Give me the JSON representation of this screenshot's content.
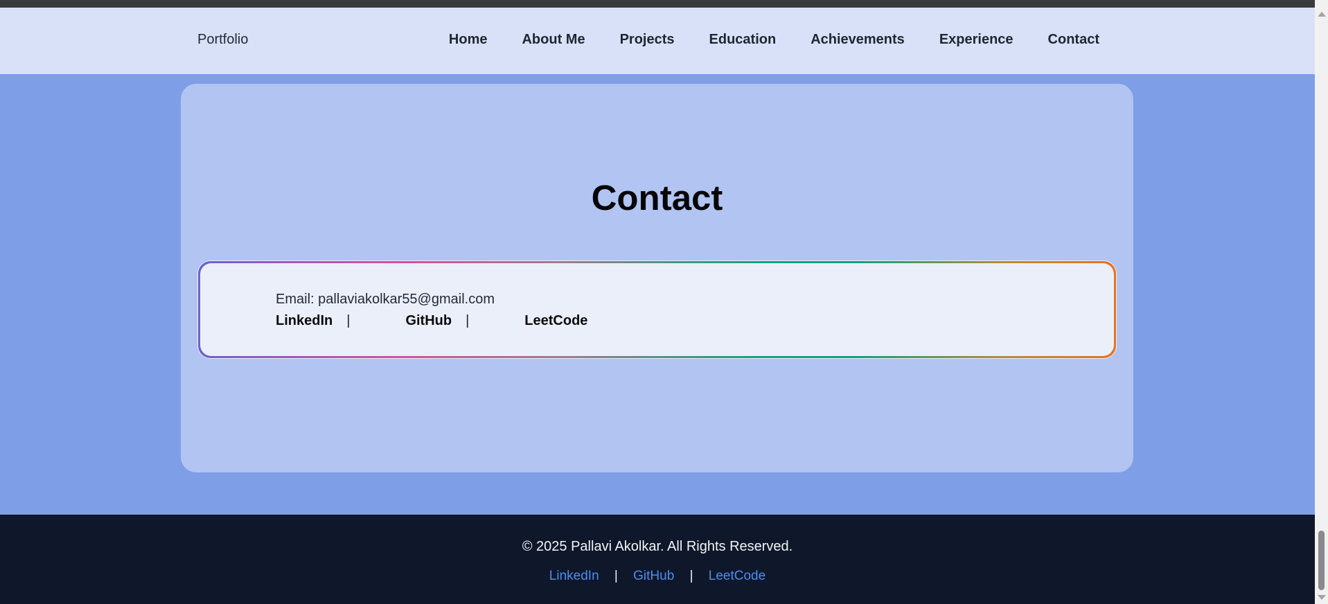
{
  "navbar": {
    "brand": "Portfolio",
    "links": [
      "Home",
      "About Me",
      "Projects",
      "Education",
      "Achievements",
      "Experience",
      "Contact"
    ]
  },
  "contact": {
    "title": "Contact",
    "email_label": "Email:",
    "email": "pallaviakolkar55@gmail.com",
    "links": [
      "LinkedIn",
      "GitHub",
      "LeetCode"
    ],
    "separator": "|"
  },
  "chat_widget": {
    "glyph": ">_<"
  },
  "footer": {
    "copyright": "© 2025 Pallavi Akolkar. All Rights Reserved.",
    "links": [
      "LinkedIn",
      "GitHub",
      "LeetCode"
    ],
    "separator": "|"
  },
  "colors": {
    "navbar_bg": "#d9e1f8",
    "page_bg": "#7f9ee8",
    "card_bg": "#b1c4f2",
    "footer_bg": "#0f172a",
    "footer_link": "#4b8ff0"
  }
}
